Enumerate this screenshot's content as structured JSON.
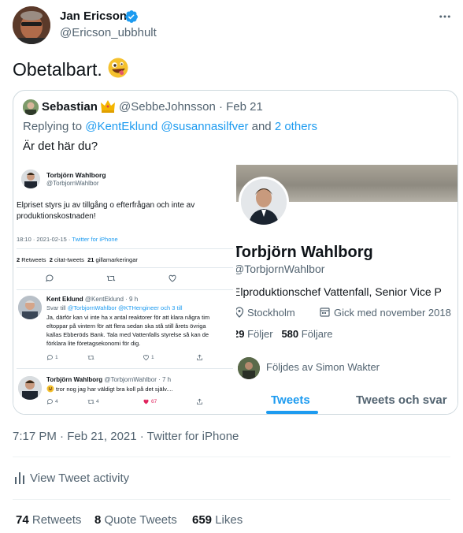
{
  "tweet": {
    "author_name": "Jan Ericson",
    "author_handle": "@Ericson_ubbhult",
    "text": "Obetalbart.",
    "timestamp": "7:17 PM · Feb 21, 2021 · Twitter for iPhone",
    "activity_label": "View Tweet activity",
    "stats": {
      "retweets_count": "74",
      "retweets_label": "Retweets",
      "quotes_count": "8",
      "quotes_label": "Quote Tweets",
      "likes_count": "659",
      "likes_label": "Likes"
    },
    "colors": {
      "accent": "#1d9bf0",
      "secondary_text": "#536471",
      "border": "#cfd9de"
    }
  },
  "quote": {
    "author_name": "Sebastian",
    "author_handle": "@SebbeJohnsson",
    "date": "· Feb 21",
    "replying_prefix": "Replying to",
    "replying_users": "@KentEklund @susannasilfver",
    "replying_suffix": "and",
    "replying_others": "2 others",
    "text": "Är det här du?",
    "left_image": {
      "name": "Torbjörn Wahlborg",
      "handle": "@TorbjornWahlbor",
      "text_line1": "Elpriset styrs ju av tillgång o efterfrågan och inte av",
      "text_line2": "produktionskostnaden!",
      "meta_time": "18:10 · 2021-02-15 ·",
      "meta_source": "Twitter for iPhone",
      "stats": "2 Retweets  2 citat-tweets  21 gillamarkeringar",
      "stat_retweets": "2",
      "stat_retweets_label": "Retweets",
      "stat_quotes": "2",
      "stat_quotes_label": "citat-tweets",
      "stat_likes": "21",
      "stat_likes_label": "gillamarkeringar",
      "reply1_name": "Kent Eklund",
      "reply1_handle": "@KentEklund · 9 h",
      "reply1_to_prefix": "Svar till",
      "reply1_to_users": "@TorbjornWahlbor @KTHengineer och 3 till",
      "reply1_lines": [
        "Ja, därför kan vi inte ha x antal reaktorer för att klara några tim",
        "eltoppar på vintern för att flera sedan ska stå still årets övriga",
        "kallas Ebberöds Bank. Tala med Vattenfalls styrelse så kan de",
        "förklara lite företagsekonomi för dig."
      ],
      "reply1_counts": [
        "1",
        "",
        "1",
        ""
      ],
      "reply2_name": "Torbjörn Wahlborg",
      "reply2_handle": "@TorbjornWahlbor · 7 h",
      "reply2_text": "tror nog jag har väldigt bra koll på det själv....",
      "reply2_counts": [
        "4",
        "4",
        "67",
        ""
      ]
    },
    "right_image": {
      "name": "Torbjörn Wahlborg",
      "handle": "@TorbjornWahlbor",
      "bio": "Elproduktionschef Vattenfall, Senior Vice P",
      "location": "Stockholm",
      "joined": "Gick med november 2018",
      "following_count": "29",
      "following_label": "Följer",
      "followers_count": "580",
      "followers_label": "Följare",
      "followed_by": "Följdes av Simon Wakter",
      "tab_tweets": "Tweets",
      "tab_replies": "Tweets och svar"
    }
  }
}
